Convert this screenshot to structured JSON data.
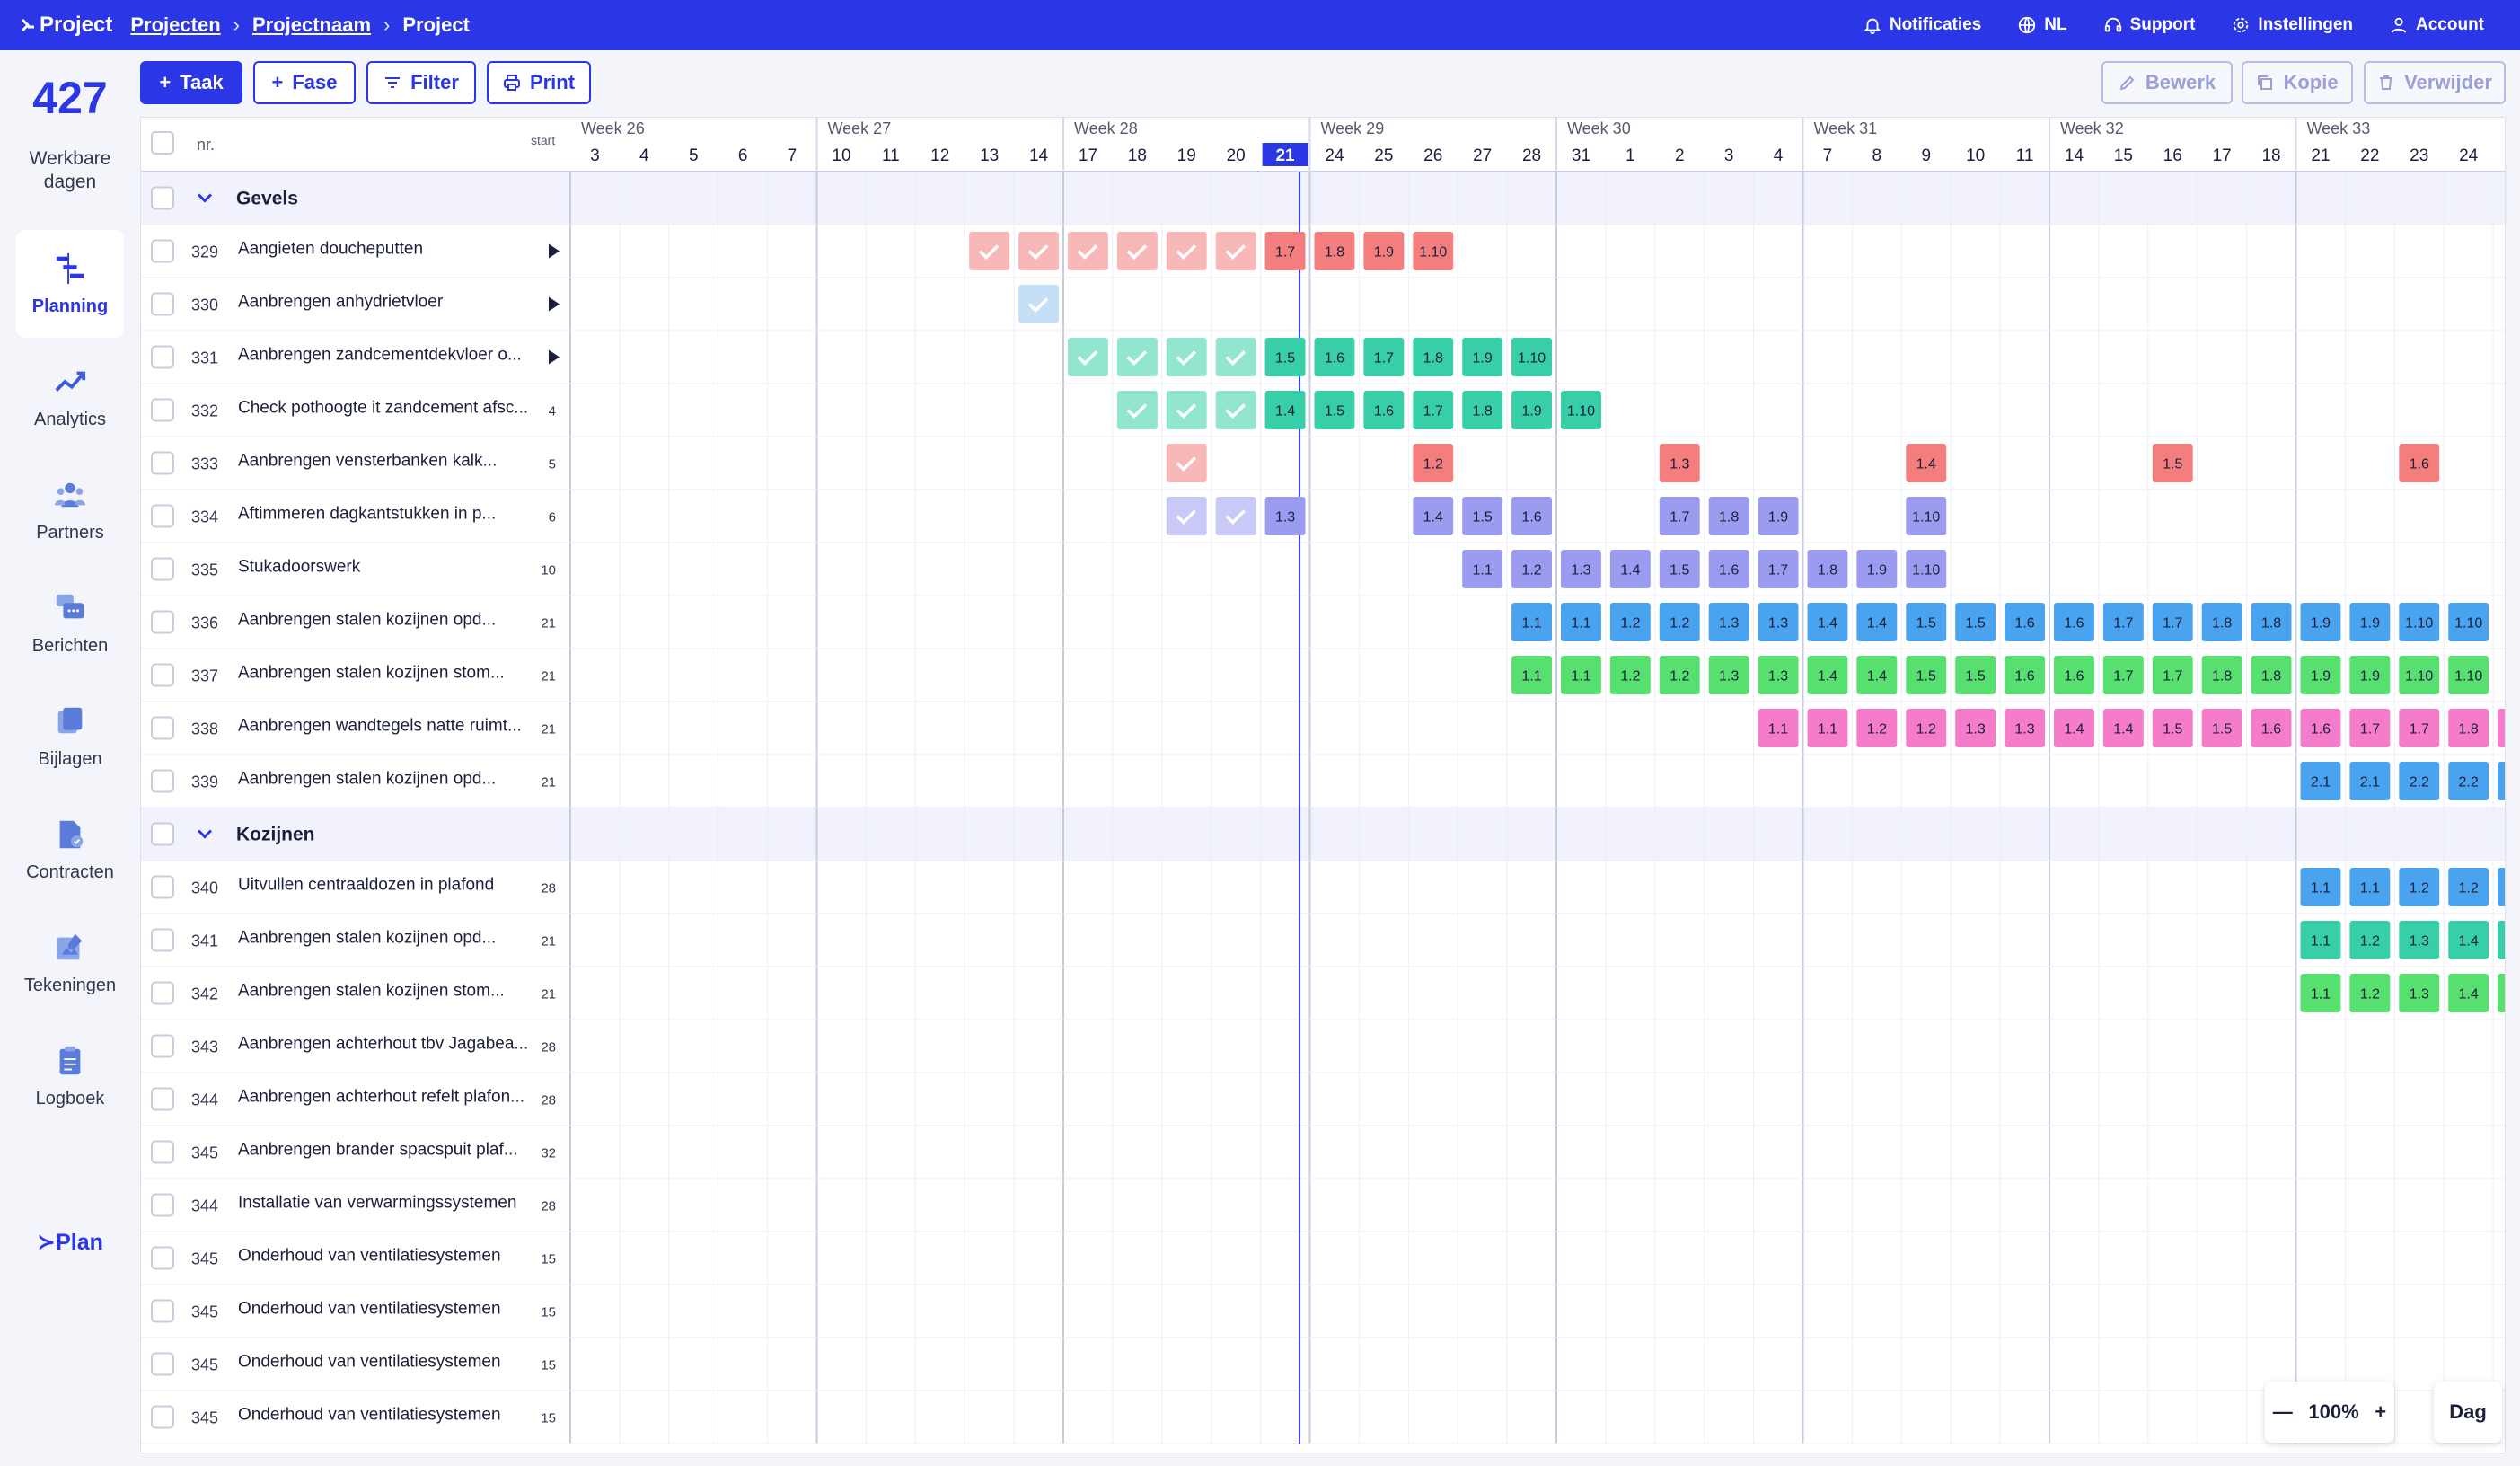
{
  "topbar": {
    "logo": "Project",
    "breadcrumb": [
      "Projecten",
      "Projectnaam",
      "Project"
    ],
    "nav": [
      {
        "label": "Notificaties",
        "icon": "bell-icon"
      },
      {
        "label": "NL",
        "icon": "globe-icon"
      },
      {
        "label": "Support",
        "icon": "headset-icon"
      },
      {
        "label": "Instellingen",
        "icon": "gear-icon"
      },
      {
        "label": "Account",
        "icon": "user-icon"
      }
    ],
    "color": "#2b36e6"
  },
  "sidebar": {
    "days_count": "427",
    "days_label": "Werkbare dagen",
    "items": [
      {
        "label": "Planning",
        "icon": "planning-icon",
        "active": true
      },
      {
        "label": "Analytics",
        "icon": "analytics-icon"
      },
      {
        "label": "Partners",
        "icon": "partners-icon"
      },
      {
        "label": "Berichten",
        "icon": "messages-icon"
      },
      {
        "label": "Bijlagen",
        "icon": "attachments-icon"
      },
      {
        "label": "Contracten",
        "icon": "contracts-icon"
      },
      {
        "label": "Tekeningen",
        "icon": "drawings-icon"
      },
      {
        "label": "Logboek",
        "icon": "logbook-icon"
      }
    ],
    "footer_logo": "Plan"
  },
  "toolbar": {
    "task": "Taak",
    "phase": "Fase",
    "filter": "Filter",
    "print": "Print",
    "edit": "Bewerk",
    "copy": "Kopie",
    "delete": "Verwijder"
  },
  "grid": {
    "header": {
      "nr": "nr.",
      "start": "start"
    },
    "today": "21",
    "weeks": [
      "Week 26",
      "Week 27",
      "Week 28",
      "Week 29",
      "Week 30",
      "Week 31",
      "Week 32",
      "Week 33"
    ],
    "days": [
      [
        "3",
        "4",
        "5",
        "6",
        "7"
      ],
      [
        "10",
        "11",
        "12",
        "13",
        "14"
      ],
      [
        "17",
        "18",
        "19",
        "20",
        "21"
      ],
      [
        "24",
        "25",
        "26",
        "27",
        "28"
      ],
      [
        "31",
        "1",
        "2",
        "3",
        "4"
      ],
      [
        "7",
        "8",
        "9",
        "10",
        "11"
      ],
      [
        "14",
        "15",
        "16",
        "17",
        "18"
      ],
      [
        "21",
        "22",
        "23",
        "24"
      ]
    ],
    "colors": {
      "red": "#f47d7d",
      "teal": "#38cfa8",
      "purple": "#9b9cf0",
      "blue": "#4aa3ee",
      "green": "#57e06f",
      "pink": "#f57bcb",
      "lightblue": "#93c5ee"
    },
    "rows": [
      {
        "type": "group",
        "name": "Gevels"
      },
      {
        "type": "task",
        "nr": "329",
        "name": "Aangieten doucheputten",
        "start": "",
        "arrow": true,
        "done": [
          [
            8,
            "red"
          ],
          [
            9,
            "red"
          ],
          [
            10,
            "red"
          ],
          [
            11,
            "red"
          ],
          [
            12,
            "red"
          ],
          [
            13,
            "red"
          ]
        ],
        "bars": [
          [
            14,
            "1.7",
            "red"
          ],
          [
            15,
            "1.8",
            "red"
          ],
          [
            16,
            "1.9",
            "red"
          ],
          [
            17,
            "1.10",
            "red"
          ]
        ]
      },
      {
        "type": "task",
        "nr": "330",
        "name": "Aanbrengen anhydrietvloer",
        "start": "",
        "arrow": true,
        "done": [
          [
            9,
            "lightblue"
          ]
        ],
        "bars": []
      },
      {
        "type": "task",
        "nr": "331",
        "name": "Aanbrengen zandcementdekvloer o...",
        "start": "",
        "arrow": true,
        "done": [
          [
            10,
            "teal"
          ],
          [
            11,
            "teal"
          ],
          [
            12,
            "teal"
          ],
          [
            13,
            "teal"
          ]
        ],
        "bars": [
          [
            14,
            "1.5",
            "teal"
          ],
          [
            15,
            "1.6",
            "teal"
          ],
          [
            16,
            "1.7",
            "teal"
          ],
          [
            17,
            "1.8",
            "teal"
          ],
          [
            18,
            "1.9",
            "teal"
          ],
          [
            19,
            "1.10",
            "teal"
          ]
        ]
      },
      {
        "type": "task",
        "nr": "332",
        "name": "Check pothoogte it zandcement afsc...",
        "start": "4",
        "done": [
          [
            11,
            "teal"
          ],
          [
            12,
            "teal"
          ],
          [
            13,
            "teal"
          ]
        ],
        "bars": [
          [
            14,
            "1.4",
            "teal"
          ],
          [
            15,
            "1.5",
            "teal"
          ],
          [
            16,
            "1.6",
            "teal"
          ],
          [
            17,
            "1.7",
            "teal"
          ],
          [
            18,
            "1.8",
            "teal"
          ],
          [
            19,
            "1.9",
            "teal"
          ],
          [
            20,
            "1.10",
            "teal"
          ]
        ]
      },
      {
        "type": "task",
        "nr": "333",
        "name": "Aanbrengen vensterbanken kalk...",
        "start": "5",
        "done": [
          [
            12,
            "red"
          ]
        ],
        "bars": [
          [
            17,
            "1.2",
            "red"
          ],
          [
            22,
            "1.3",
            "red"
          ],
          [
            27,
            "1.4",
            "red"
          ],
          [
            32,
            "1.5",
            "red"
          ],
          [
            37,
            "1.6",
            "red"
          ]
        ]
      },
      {
        "type": "task",
        "nr": "334",
        "name": "Aftimmeren dagkantstukken in p...",
        "start": "6",
        "done": [
          [
            12,
            "purple"
          ],
          [
            13,
            "purple"
          ]
        ],
        "bars": [
          [
            14,
            "1.3",
            "purple"
          ],
          [
            17,
            "1.4",
            "purple"
          ],
          [
            18,
            "1.5",
            "purple"
          ],
          [
            19,
            "1.6",
            "purple"
          ],
          [
            22,
            "1.7",
            "purple"
          ],
          [
            23,
            "1.8",
            "purple"
          ],
          [
            24,
            "1.9",
            "purple"
          ],
          [
            27,
            "1.10",
            "purple"
          ]
        ]
      },
      {
        "type": "task",
        "nr": "335",
        "name": "Stukadoorswerk",
        "start": "10",
        "done": [],
        "bars": [
          [
            18,
            "1.1",
            "purple"
          ],
          [
            19,
            "1.2",
            "purple"
          ],
          [
            20,
            "1.3",
            "purple"
          ],
          [
            21,
            "1.4",
            "purple"
          ],
          [
            22,
            "1.5",
            "purple"
          ],
          [
            23,
            "1.6",
            "purple"
          ],
          [
            24,
            "1.7",
            "purple"
          ],
          [
            25,
            "1.8",
            "purple"
          ],
          [
            26,
            "1.9",
            "purple"
          ],
          [
            27,
            "1.10",
            "purple"
          ]
        ]
      },
      {
        "type": "task",
        "nr": "336",
        "name": "Aanbrengen stalen kozijnen opd...",
        "start": "21",
        "done": [],
        "bars": [
          [
            19,
            "1.1",
            "blue"
          ],
          [
            20,
            "1.1",
            "blue"
          ],
          [
            21,
            "1.2",
            "blue"
          ],
          [
            22,
            "1.2",
            "blue"
          ],
          [
            23,
            "1.3",
            "blue"
          ],
          [
            24,
            "1.3",
            "blue"
          ],
          [
            25,
            "1.4",
            "blue"
          ],
          [
            26,
            "1.4",
            "blue"
          ],
          [
            27,
            "1.5",
            "blue"
          ],
          [
            28,
            "1.5",
            "blue"
          ],
          [
            29,
            "1.6",
            "blue"
          ],
          [
            30,
            "1.6",
            "blue"
          ],
          [
            31,
            "1.7",
            "blue"
          ],
          [
            32,
            "1.7",
            "blue"
          ],
          [
            33,
            "1.8",
            "blue"
          ],
          [
            34,
            "1.8",
            "blue"
          ],
          [
            35,
            "1.9",
            "blue"
          ],
          [
            36,
            "1.9",
            "blue"
          ],
          [
            37,
            "1.10",
            "blue"
          ],
          [
            38,
            "1.10",
            "blue"
          ]
        ]
      },
      {
        "type": "task",
        "nr": "337",
        "name": "Aanbrengen stalen kozijnen stom...",
        "start": "21",
        "done": [],
        "bars": [
          [
            19,
            "1.1",
            "green"
          ],
          [
            20,
            "1.1",
            "green"
          ],
          [
            21,
            "1.2",
            "green"
          ],
          [
            22,
            "1.2",
            "green"
          ],
          [
            23,
            "1.3",
            "green"
          ],
          [
            24,
            "1.3",
            "green"
          ],
          [
            25,
            "1.4",
            "green"
          ],
          [
            26,
            "1.4",
            "green"
          ],
          [
            27,
            "1.5",
            "green"
          ],
          [
            28,
            "1.5",
            "green"
          ],
          [
            29,
            "1.6",
            "green"
          ],
          [
            30,
            "1.6",
            "green"
          ],
          [
            31,
            "1.7",
            "green"
          ],
          [
            32,
            "1.7",
            "green"
          ],
          [
            33,
            "1.8",
            "green"
          ],
          [
            34,
            "1.8",
            "green"
          ],
          [
            35,
            "1.9",
            "green"
          ],
          [
            36,
            "1.9",
            "green"
          ],
          [
            37,
            "1.10",
            "green"
          ],
          [
            38,
            "1.10",
            "green"
          ]
        ]
      },
      {
        "type": "task",
        "nr": "338",
        "name": "Aanbrengen wandtegels natte ruimt...",
        "start": "21",
        "done": [],
        "bars": [
          [
            24,
            "1.1",
            "pink"
          ],
          [
            25,
            "1.1",
            "pink"
          ],
          [
            26,
            "1.2",
            "pink"
          ],
          [
            27,
            "1.2",
            "pink"
          ],
          [
            28,
            "1.3",
            "pink"
          ],
          [
            29,
            "1.3",
            "pink"
          ],
          [
            30,
            "1.4",
            "pink"
          ],
          [
            31,
            "1.4",
            "pink"
          ],
          [
            32,
            "1.5",
            "pink"
          ],
          [
            33,
            "1.5",
            "pink"
          ],
          [
            34,
            "1.6",
            "pink"
          ],
          [
            35,
            "1.6",
            "pink"
          ],
          [
            36,
            "1.7",
            "pink"
          ],
          [
            37,
            "1.7",
            "pink"
          ],
          [
            38,
            "1.8",
            "pink"
          ],
          [
            39,
            "",
            "pink"
          ]
        ]
      },
      {
        "type": "task",
        "nr": "339",
        "name": "Aanbrengen stalen kozijnen opd...",
        "start": "21",
        "done": [],
        "bars": [
          [
            35,
            "2.1",
            "blue"
          ],
          [
            36,
            "2.1",
            "blue"
          ],
          [
            37,
            "2.2",
            "blue"
          ],
          [
            38,
            "2.2",
            "blue"
          ],
          [
            39,
            "",
            "blue"
          ]
        ]
      },
      {
        "type": "group",
        "name": "Kozijnen"
      },
      {
        "type": "task",
        "nr": "340",
        "name": "Uitvullen centraaldozen in plafond",
        "start": "28",
        "done": [],
        "bars": [
          [
            35,
            "1.1",
            "blue"
          ],
          [
            36,
            "1.1",
            "blue"
          ],
          [
            37,
            "1.2",
            "blue"
          ],
          [
            38,
            "1.2",
            "blue"
          ],
          [
            39,
            "",
            "blue"
          ]
        ]
      },
      {
        "type": "task",
        "nr": "341",
        "name": "Aanbrengen stalen kozijnen opd...",
        "start": "21",
        "done": [],
        "bars": [
          [
            35,
            "1.1",
            "teal"
          ],
          [
            36,
            "1.2",
            "teal"
          ],
          [
            37,
            "1.3",
            "teal"
          ],
          [
            38,
            "1.4",
            "teal"
          ],
          [
            39,
            "",
            "teal"
          ]
        ]
      },
      {
        "type": "task",
        "nr": "342",
        "name": "Aanbrengen stalen kozijnen stom...",
        "start": "21",
        "done": [],
        "bars": [
          [
            35,
            "1.1",
            "green"
          ],
          [
            36,
            "1.2",
            "green"
          ],
          [
            37,
            "1.3",
            "green"
          ],
          [
            38,
            "1.4",
            "green"
          ],
          [
            39,
            "",
            "green"
          ]
        ]
      },
      {
        "type": "task",
        "nr": "343",
        "name": "Aanbrengen achterhout tbv Jagabea...",
        "start": "28",
        "done": [],
        "bars": []
      },
      {
        "type": "task",
        "nr": "344",
        "name": "Aanbrengen achterhout refelt plafon...",
        "start": "28",
        "done": [],
        "bars": []
      },
      {
        "type": "task",
        "nr": "345",
        "name": "Aanbrengen brander spacspuit plaf...",
        "start": "32",
        "done": [],
        "bars": []
      },
      {
        "type": "task",
        "nr": "344",
        "name": "Installatie van verwarmingssystemen",
        "start": "28",
        "done": [],
        "bars": []
      },
      {
        "type": "task",
        "nr": "345",
        "name": "Onderhoud van ventilatiesystemen",
        "start": "15",
        "done": [],
        "bars": []
      },
      {
        "type": "task",
        "nr": "345",
        "name": "Onderhoud van ventilatiesystemen",
        "start": "15",
        "done": [],
        "bars": []
      },
      {
        "type": "task",
        "nr": "345",
        "name": "Onderhoud van ventilatiesystemen",
        "start": "15",
        "done": [],
        "bars": []
      },
      {
        "type": "task",
        "nr": "345",
        "name": "Onderhoud van ventilatiesystemen",
        "start": "15",
        "done": [],
        "bars": []
      }
    ]
  },
  "zoom": {
    "value": "100%",
    "view": "Dag"
  }
}
